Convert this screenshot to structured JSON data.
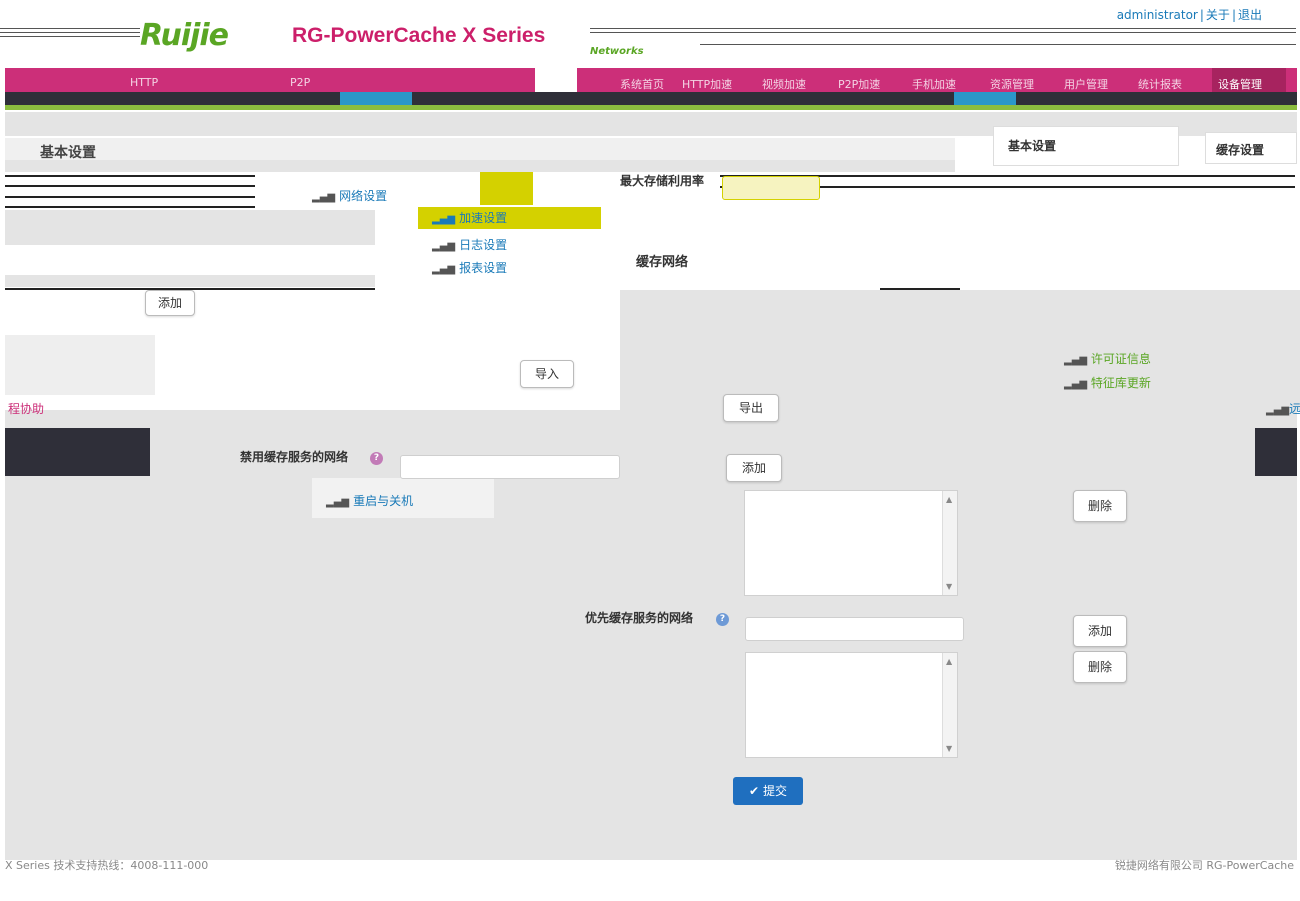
{
  "header": {
    "logo": "Ruijie",
    "product": "RG-PowerCache X Series",
    "networks": "Networks",
    "user": "administrator",
    "about": "关于",
    "logout": "退出",
    "separator": "|"
  },
  "nav": {
    "left_items": [
      "HTTP",
      "P2P"
    ],
    "right_items": [
      "系统首页",
      "HTTP加速",
      "视频加速",
      "P2P加速",
      "手机加速",
      "资源管理",
      "用户管理",
      "统计报表",
      "设备管理"
    ]
  },
  "section_title": "基本设置",
  "menu": {
    "network_settings": "网络设置",
    "cache_settings": "加速设置",
    "log_settings": "日志设置",
    "report_settings": "报表设置",
    "reboot": "重启与关机"
  },
  "panels": {
    "basic_settings_tab": "基本设置",
    "cache_settings_tab": "缓存设置",
    "license_info": "许可证信息",
    "feature_update": "特征库更新"
  },
  "side": {
    "remote_assist": "程协助",
    "remote_right": "远"
  },
  "form": {
    "max_storage_label": "最大存储利用率",
    "cache_network_heading": "缓存网络",
    "disabled_network_label": "禁用缓存服务的网络",
    "priority_network_label": "优先缓存服务的网络",
    "add": "添加",
    "delete": "删除",
    "import": "导入",
    "export": "导出",
    "submit": "提交",
    "submit_icon": "✔"
  },
  "footer": {
    "left": "X Series  技术支持热线：4008-111-000",
    "right": "锐捷网络有限公司 RG-PowerCache"
  },
  "colors": {
    "brand_pink": "#cc2f79",
    "brand_green": "#5aa624",
    "link_blue": "#1a7ab8",
    "active_yellow": "#d4d100",
    "submit_blue": "#1f6fbf"
  }
}
